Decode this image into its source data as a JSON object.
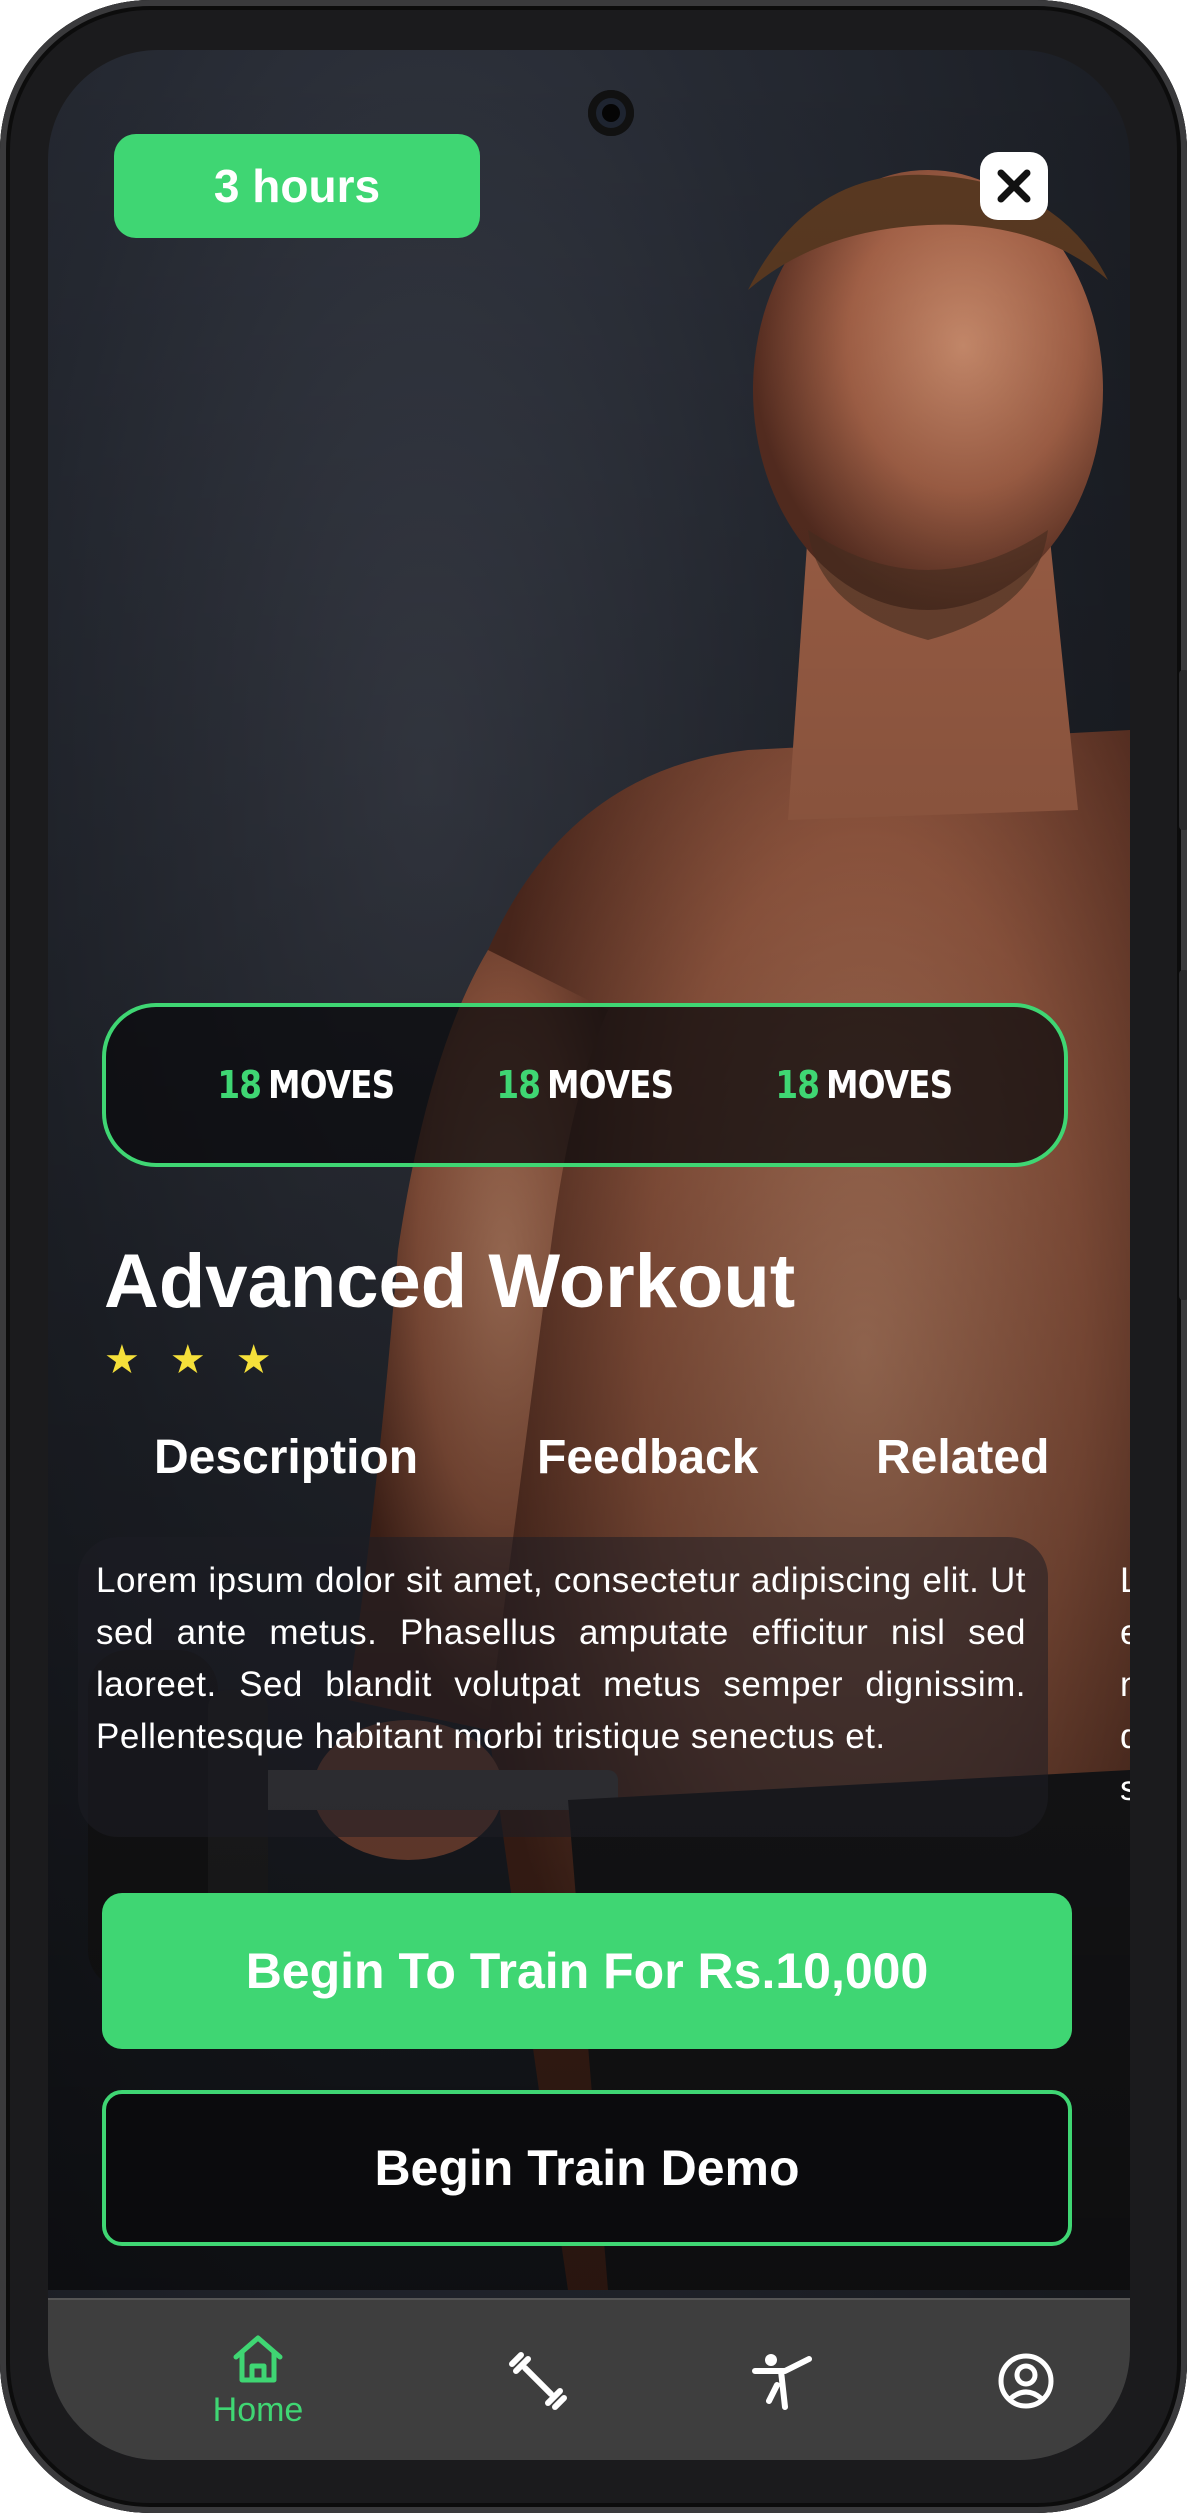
{
  "header": {
    "duration_badge": "3 hours",
    "close_icon": "close-icon"
  },
  "stats": [
    {
      "number": "18",
      "label": "MOVES"
    },
    {
      "number": "18",
      "label": "MOVES"
    },
    {
      "number": "18",
      "label": "MOVES"
    }
  ],
  "workout": {
    "title": "Advanced Workout",
    "rating_stars": 3
  },
  "tabs": [
    {
      "label": "Description"
    },
    {
      "label": "Feedback"
    },
    {
      "label": "Related"
    }
  ],
  "description": {
    "text": "Lorem ipsum dolor sit amet, consectetur adipiscing elit. Ut sed ante metus. Phasellus amputate efficitur nisl sed laoreet. Sed blandit volutpat metus semper dignissim. Pellentesque habitant morbi tristique senectus et.",
    "next_card_peek": "L\ne\nn\nd\ns"
  },
  "actions": {
    "primary": "Begin To Train For Rs.10,000",
    "secondary": "Begin Train Demo"
  },
  "bottom_nav": {
    "items": [
      {
        "label": "Home",
        "icon": "home-icon",
        "active": true
      },
      {
        "label": "",
        "icon": "dumbbell-icon",
        "active": false
      },
      {
        "label": "",
        "icon": "martial-arts-icon",
        "active": false
      },
      {
        "label": "",
        "icon": "profile-icon",
        "active": false
      }
    ]
  },
  "colors": {
    "accent": "#3fd673",
    "star": "#f5e03a",
    "nav_bg": "#3e3e3e"
  }
}
